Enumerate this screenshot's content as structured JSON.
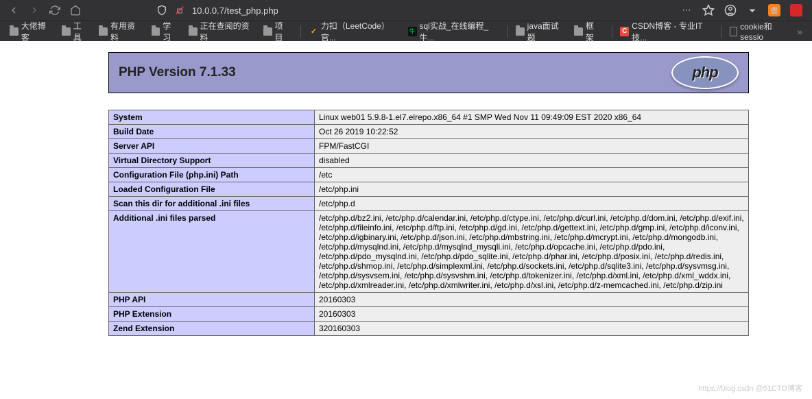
{
  "browser": {
    "url": "10.0.0.7/test_php.php"
  },
  "bookmarks": [
    {
      "label": "大佬博客",
      "icon": "folder"
    },
    {
      "label": "工具",
      "icon": "folder"
    },
    {
      "label": "有用资料",
      "icon": "folder"
    },
    {
      "label": "学习",
      "icon": "folder"
    },
    {
      "label": "正在查阅的资料",
      "icon": "folder"
    },
    {
      "label": "项目",
      "icon": "folder"
    },
    {
      "label": "力扣（LeetCode）官...",
      "icon": "leetcode"
    },
    {
      "label": "sql实战_在线编程_牛...",
      "icon": "nowcoder"
    },
    {
      "label": "java面试题",
      "icon": "folder"
    },
    {
      "label": "框架",
      "icon": "folder"
    },
    {
      "label": "CSDN博客 - 专业IT技...",
      "icon": "csdn"
    },
    {
      "label": "cookie和sessio",
      "icon": "page"
    }
  ],
  "header": {
    "title": "PHP Version 7.1.33",
    "logo_text": "php"
  },
  "rows": [
    {
      "k": "System",
      "v": "Linux web01 5.9.8-1.el7.elrepo.x86_64 #1 SMP Wed Nov 11 09:49:09 EST 2020 x86_64"
    },
    {
      "k": "Build Date",
      "v": "Oct 26 2019 10:22:52"
    },
    {
      "k": "Server API",
      "v": "FPM/FastCGI"
    },
    {
      "k": "Virtual Directory Support",
      "v": "disabled"
    },
    {
      "k": "Configuration File (php.ini) Path",
      "v": "/etc"
    },
    {
      "k": "Loaded Configuration File",
      "v": "/etc/php.ini"
    },
    {
      "k": "Scan this dir for additional .ini files",
      "v": "/etc/php.d"
    },
    {
      "k": "Additional .ini files parsed",
      "v": "/etc/php.d/bz2.ini, /etc/php.d/calendar.ini, /etc/php.d/ctype.ini, /etc/php.d/curl.ini, /etc/php.d/dom.ini, /etc/php.d/exif.ini, /etc/php.d/fileinfo.ini, /etc/php.d/ftp.ini, /etc/php.d/gd.ini, /etc/php.d/gettext.ini, /etc/php.d/gmp.ini, /etc/php.d/iconv.ini, /etc/php.d/igbinary.ini, /etc/php.d/json.ini, /etc/php.d/mbstring.ini, /etc/php.d/mcrypt.ini, /etc/php.d/mongodb.ini, /etc/php.d/mysqlnd.ini, /etc/php.d/mysqlnd_mysqli.ini, /etc/php.d/opcache.ini, /etc/php.d/pdo.ini, /etc/php.d/pdo_mysqlnd.ini, /etc/php.d/pdo_sqlite.ini, /etc/php.d/phar.ini, /etc/php.d/posix.ini, /etc/php.d/redis.ini, /etc/php.d/shmop.ini, /etc/php.d/simplexml.ini, /etc/php.d/sockets.ini, /etc/php.d/sqlite3.ini, /etc/php.d/sysvmsg.ini, /etc/php.d/sysvsem.ini, /etc/php.d/sysvshm.ini, /etc/php.d/tokenizer.ini, /etc/php.d/xml.ini, /etc/php.d/xml_wddx.ini, /etc/php.d/xmlreader.ini, /etc/php.d/xmlwriter.ini, /etc/php.d/xsl.ini, /etc/php.d/z-memcached.ini, /etc/php.d/zip.ini"
    },
    {
      "k": "PHP API",
      "v": "20160303"
    },
    {
      "k": "PHP Extension",
      "v": "20160303"
    },
    {
      "k": "Zend Extension",
      "v": "320160303"
    }
  ],
  "watermark": "https://blog.csdn @51CTO博客"
}
